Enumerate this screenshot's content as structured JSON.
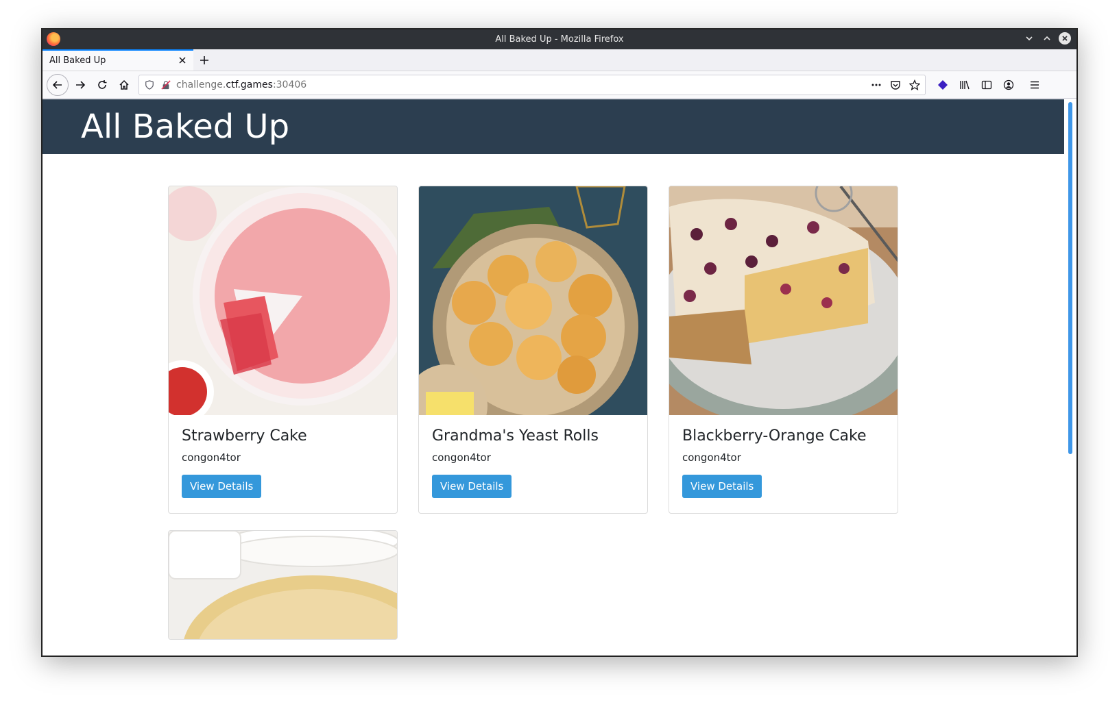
{
  "window": {
    "title": "All Baked Up - Mozilla Firefox"
  },
  "tab": {
    "label": "All Baked Up"
  },
  "urlbar": {
    "host_pre": "challenge.",
    "host_main": "ctf.games",
    "port": ":30406"
  },
  "site": {
    "title": "All Baked Up"
  },
  "recipes": [
    {
      "name": "Strawberry Cake",
      "author": "congon4tor",
      "button": "View Details"
    },
    {
      "name": "Grandma's Yeast Rolls",
      "author": "congon4tor",
      "button": "View Details"
    },
    {
      "name": "Blackberry-Orange Cake",
      "author": "congon4tor",
      "button": "View Details"
    }
  ],
  "colors": {
    "header_bg": "#2c3e50",
    "button_bg": "#3498db"
  }
}
